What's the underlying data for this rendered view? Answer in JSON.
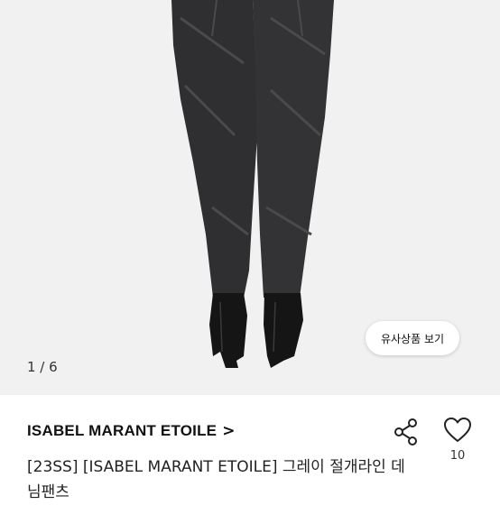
{
  "gallery": {
    "similar_button_label": "유사상품 보기",
    "counter": "1 / 6"
  },
  "product": {
    "brand": "ISABEL MARANT ETOILE",
    "brand_chevron": ">",
    "title": "[23SS] [ISABEL MARANT ETOILE] 그레이 절개라인 데님팬츠"
  },
  "actions": {
    "like_count": "10",
    "share_icon": "share-icon",
    "like_icon": "heart-icon"
  }
}
